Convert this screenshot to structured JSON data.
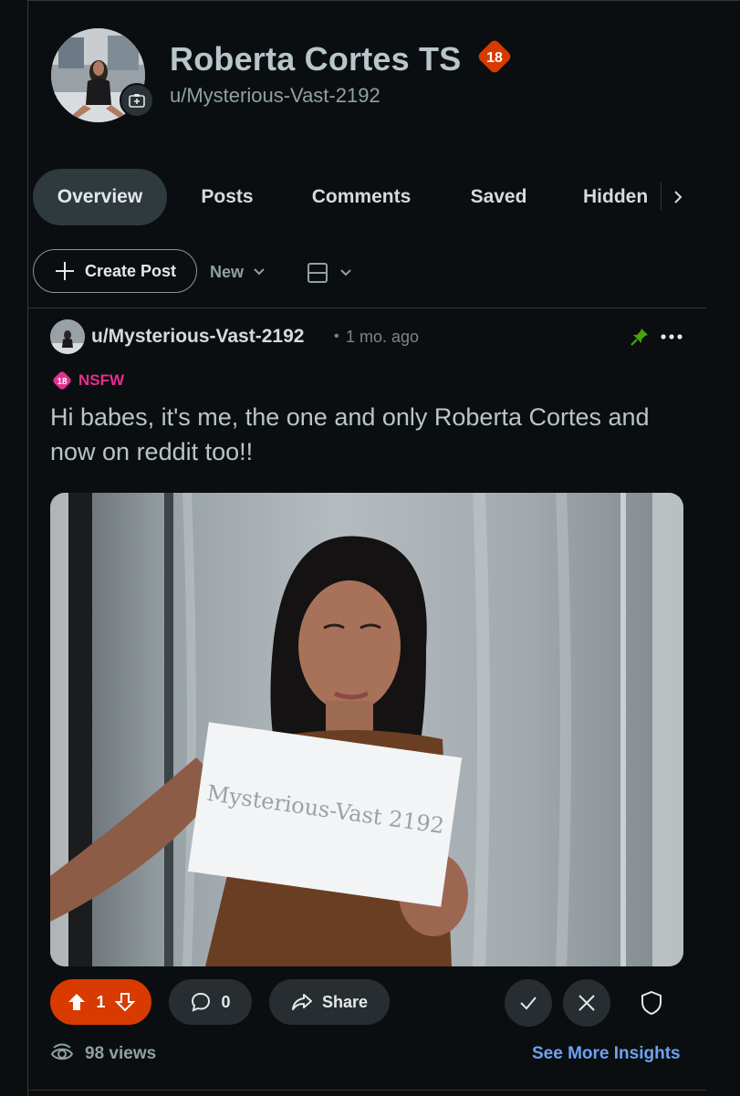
{
  "profile": {
    "display_name": "Roberta Cortes TS",
    "nsfw_badge": "18",
    "username": "u/Mysterious-Vast-2192",
    "avatar_icon": "profile-photo",
    "add_photo_icon": "add-photo-icon"
  },
  "tabs": [
    {
      "label": "Overview",
      "active": true
    },
    {
      "label": "Posts",
      "active": false
    },
    {
      "label": "Comments",
      "active": false
    },
    {
      "label": "Saved",
      "active": false
    },
    {
      "label": "Hidden",
      "active": false
    }
  ],
  "toolbar": {
    "create_post_label": "Create Post",
    "sort_label": "New"
  },
  "post": {
    "author": "u/Mysterious-Vast-2192",
    "separator": "•",
    "time": "1 mo. ago",
    "nsfw_badge": "18",
    "nsfw_label": "NSFW",
    "title": "Hi babes, it's me, the one and only Roberta Cortes and now on reddit too!!",
    "score": "1",
    "comments": "0",
    "share_label": "Share",
    "sign_text": "Mysterious-Vast 2192",
    "views": "98 views",
    "insights_label": "See More Insights"
  },
  "colors": {
    "background": "#0b0e10",
    "upvote_active": "#d93a00",
    "nsfw": "#e42f8f",
    "badge18": "#d93a00",
    "link": "#6ea2f0",
    "pin": "#46a508"
  }
}
